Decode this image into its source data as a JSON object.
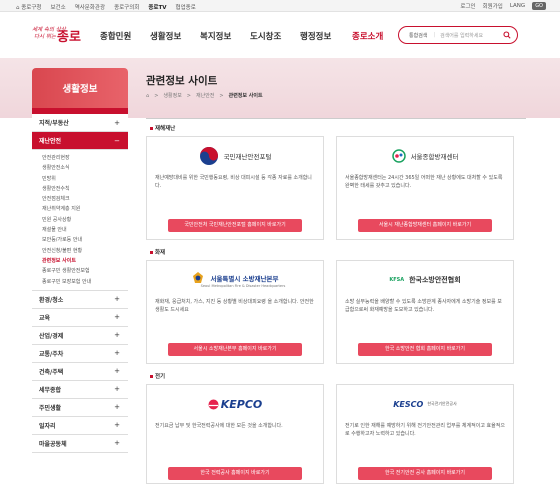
{
  "topbar": {
    "links": [
      "종로구청",
      "보건소",
      "역사문화관광",
      "종로구의회",
      "종로TV",
      "협업종로"
    ],
    "active_index": 4,
    "login": "로그인",
    "join": "회원가입",
    "lang": "LANG",
    "go": "GO"
  },
  "logo": {
    "line1": "세계 속의 상상",
    "line2": "다시 뛰는",
    "main": "종로"
  },
  "gnb": [
    "종합민원",
    "생활정보",
    "복지정보",
    "도시창조",
    "행정정보",
    "종로소개"
  ],
  "search": {
    "select": "통합검색",
    "placeholder": "검색어를 입력하세요"
  },
  "sidebar": {
    "title": "생활정보",
    "items": [
      {
        "label": "지적/부동산",
        "sign": "+"
      },
      {
        "label": "재난안전",
        "sign": "−",
        "active": true
      }
    ],
    "sub": [
      "안전관리현장",
      "생활안전소식",
      "민방위",
      "생활안전수칙",
      "안전점검체크",
      "재난취약계층 지원",
      "민원 공사상황",
      "재설물 안내",
      "보안등/가로등 안내",
      "안전신청/불편 현황",
      "관련정보 사이트",
      "종로구민 생활안전보험",
      "종로구민 보장보험 안내"
    ],
    "sub_current_index": 10,
    "items2": [
      {
        "label": "환경/청소",
        "sign": "+"
      },
      {
        "label": "교육",
        "sign": "+"
      },
      {
        "label": "산업/경제",
        "sign": "+"
      },
      {
        "label": "교통/주차",
        "sign": "+"
      },
      {
        "label": "건축/주택",
        "sign": "+"
      },
      {
        "label": "세무종합",
        "sign": "+"
      },
      {
        "label": "주민생활",
        "sign": "+"
      },
      {
        "label": "일자리",
        "sign": "+"
      },
      {
        "label": "마을공동체",
        "sign": "+"
      }
    ]
  },
  "page": {
    "title": "관련정보 사이트",
    "crumbs": [
      "생활정보",
      "재난안전",
      "관련정보 사이트"
    ]
  },
  "sections": [
    {
      "title": "재해재난",
      "cards": [
        {
          "logo": "국민재난안전포털",
          "desc": "재난예방대비를 위한 국민행동요령, 비상 대피시설 등 각종 자료를 소개합니다.",
          "btn": "국민안전처 국민재난안전포털 홈페이지 바로가기"
        },
        {
          "logo": "서울종합방재센터",
          "desc": "서울종합방재센터는 24시간 365일 어떠한 재난 상황에도 대처할 수 있도록 완벽한 태세를 갖추고 있습니다.",
          "btn": "서울시 재난종합방재센터 홈페이지 바로가기"
        }
      ]
    },
    {
      "title": "화재",
      "cards": [
        {
          "logo": "서울특별시 소방재난본부",
          "logo_sub": "Seoul Metropolitan Fire & Disaster Headquarters",
          "desc": "재화재, 응급처치, 가스, 지진 등 상황별 비상대피요령 을 소개합니다. 안전한 생활도 드시세요",
          "btn": "서울시 소방재난본부 홈페이지 바로가기"
        },
        {
          "logo": "한국소방안전협회",
          "logo_abbr": "KFSA",
          "desc": "소방 실무능력을 배양할 수 있도록 소방관계 종사자에게 소방기술 정보를 보급함으로써 화재예방을 도모하고 있습니다.",
          "btn": "한국 소방안전 협회 홈페이지 바로가기"
        }
      ]
    },
    {
      "title": "전기",
      "cards": [
        {
          "logo": "KEPCO",
          "desc": "전기요금 납부 및 한국전력공사에 대한 모든 것을 소개합니다.",
          "btn": "한국 전력공사 홈페이지 바로가기"
        },
        {
          "logo": "KESCO",
          "logo_sub": "한국전기안전공사",
          "desc": "전기로 인한 재해를 예방하기 위해 전기안전관리 업무를 체계적이고 효율적으로 수행하고자 노력하고 있습니다.",
          "btn": "한국 전기안전 공사 홈페이지 바로가기"
        }
      ]
    }
  ],
  "colors": {
    "brand": "#c8102e",
    "button": "#e8495e"
  }
}
